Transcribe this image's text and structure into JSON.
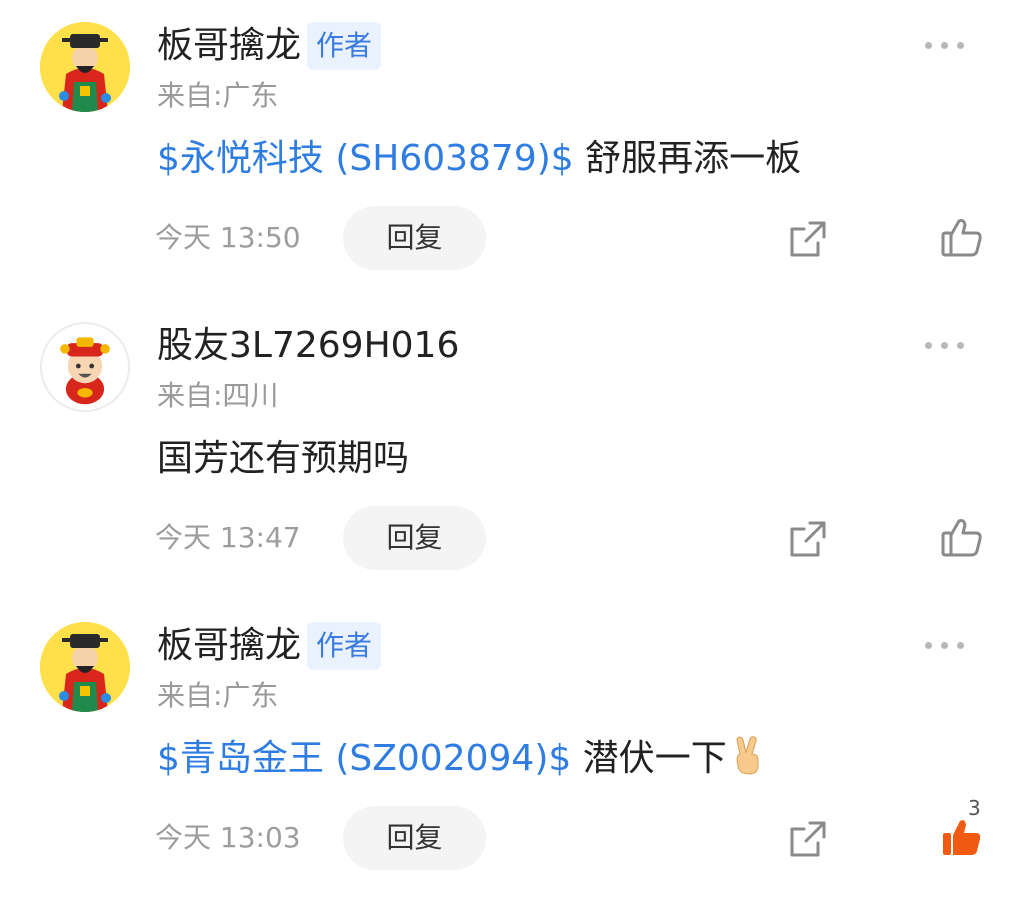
{
  "comments": [
    {
      "username": "板哥擒龙",
      "badge": "作者",
      "location": "来自:广东",
      "stock_tag": "$永悦科技 (SH603879)$",
      "text": " 舒服再添一板",
      "time": "今天 13:50",
      "reply_label": "回复",
      "like_count": "",
      "liked": false,
      "avatar": "caishen-gold-avatar"
    },
    {
      "username": "股友3L7269H016",
      "badge": "",
      "location": "来自:四川",
      "stock_tag": "",
      "text": "国芳还有预期吗",
      "time": "今天 13:47",
      "reply_label": "回复",
      "like_count": "",
      "liked": false,
      "avatar": "caishen-cartoon-avatar"
    },
    {
      "username": "板哥擒龙",
      "badge": "作者",
      "location": "来自:广东",
      "stock_tag": "$青岛金王 (SZ002094)$",
      "text": " 潜伏一下",
      "time": "今天 13:03",
      "reply_label": "回复",
      "like_count": "3",
      "liked": true,
      "avatar": "caishen-gold-avatar"
    }
  ],
  "icons": {
    "more": "more-dots-icon",
    "share": "share-icon",
    "like": "thumbs-up-icon",
    "emoji": "victory-hand-emoji"
  },
  "colors": {
    "stock_link": "#2f7de1",
    "badge_bg": "#eaf2ff",
    "badge_text": "#3a7be0",
    "liked": "#f05a12",
    "muted": "#9d9d9d"
  }
}
